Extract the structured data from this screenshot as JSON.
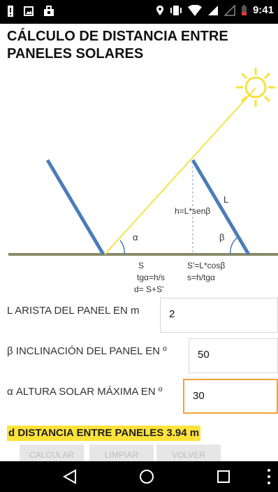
{
  "status_bar": {
    "time": "9:41",
    "left_icons": [
      "alert-icon",
      "image-icon",
      "bag-icon"
    ],
    "right_icons": [
      "location-icon",
      "vibrate-icon",
      "wifi-icon",
      "signal-icon",
      "signal-empty-icon",
      "battery-icon"
    ]
  },
  "app": {
    "title": "CÁLCULO DE DISTANCIA ENTRE PANELES SOLARES"
  },
  "diagram": {
    "labels": {
      "alpha": "α",
      "beta": "β",
      "L": "L",
      "h": "h=L*senβ",
      "S": "S",
      "S_prime": "S'=L*cosβ",
      "tg": "tgα=h/s",
      "s": "s=h/tgα",
      "d": "d= S+S'"
    },
    "colors": {
      "panel": "#4a7db8",
      "ray": "#f4e44a",
      "sun": "#f7e23a",
      "ground": "#8a8a6a"
    }
  },
  "form": {
    "fields": [
      {
        "label": "L ARISTA DEL PANEL EN m",
        "value": "2"
      },
      {
        "label": "β INCLINACIÓN DEL PANEL EN º",
        "value": "50"
      },
      {
        "label": "α ALTURA SOLAR MÁXIMA EN º",
        "value": "30"
      }
    ],
    "result": "d DISTANCIA ENTRE PANELES 3.94 m",
    "buttons": [
      "CALCULAR",
      "LIMPIAR",
      "VOLVER"
    ]
  },
  "nav_bar": {
    "buttons": [
      "back-icon",
      "home-icon",
      "recents-icon",
      "more-icon"
    ]
  }
}
